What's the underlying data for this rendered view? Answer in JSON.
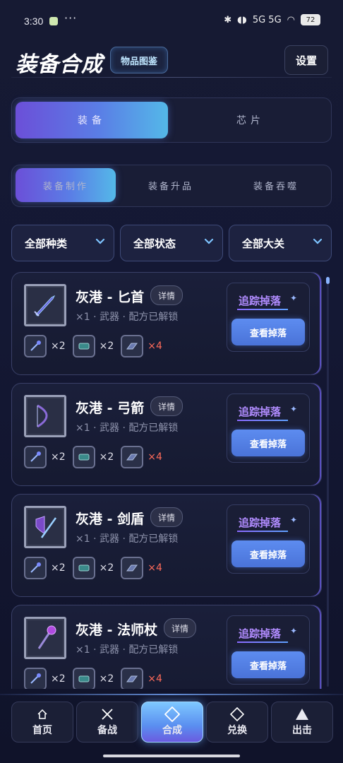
{
  "status_bar": {
    "time": "3:30",
    "dots": "···",
    "network": "5G 5G",
    "battery": "72"
  },
  "header": {
    "title": "装备合成",
    "catalog_label": "物品图鉴",
    "settings_label": "设置"
  },
  "main_tabs": [
    {
      "label": "装备",
      "active": true
    },
    {
      "label": "芯片",
      "active": false
    }
  ],
  "sub_tabs": [
    {
      "label": "装备制作",
      "active": true
    },
    {
      "label": "装备升品",
      "active": false
    },
    {
      "label": "装备吞噬",
      "active": false
    }
  ],
  "filters": [
    {
      "label": "全部种类"
    },
    {
      "label": "全部状态"
    },
    {
      "label": "全部大关"
    }
  ],
  "items": [
    {
      "name": "灰港 - 匕首",
      "detail_label": "详情",
      "meta": "×1 · 武器 · 配方已解锁",
      "icon": "dagger-icon",
      "materials": [
        {
          "icon": "rod-material-icon",
          "qty": "×2",
          "sufficient": true
        },
        {
          "icon": "chip-material-icon",
          "qty": "×2",
          "sufficient": true
        },
        {
          "icon": "gear-material-icon",
          "qty": "×4",
          "sufficient": false
        }
      ],
      "track_label": "追踪掉落",
      "view_label": "查看掉落"
    },
    {
      "name": "灰港 - 弓箭",
      "detail_label": "详情",
      "meta": "×1 · 武器 · 配方已解锁",
      "icon": "bow-icon",
      "materials": [
        {
          "icon": "rod-material-icon",
          "qty": "×2",
          "sufficient": true
        },
        {
          "icon": "chip-material-icon",
          "qty": "×2",
          "sufficient": true
        },
        {
          "icon": "gear-material-icon",
          "qty": "×4",
          "sufficient": false
        }
      ],
      "track_label": "追踪掉落",
      "view_label": "查看掉落"
    },
    {
      "name": "灰港 - 剑盾",
      "detail_label": "详情",
      "meta": "×1 · 武器 · 配方已解锁",
      "icon": "sword-shield-icon",
      "materials": [
        {
          "icon": "rod-material-icon",
          "qty": "×2",
          "sufficient": true
        },
        {
          "icon": "chip-material-icon",
          "qty": "×2",
          "sufficient": true
        },
        {
          "icon": "gear-material-icon",
          "qty": "×4",
          "sufficient": false
        }
      ],
      "track_label": "追踪掉落",
      "view_label": "查看掉落"
    },
    {
      "name": "灰港 - 法师杖",
      "detail_label": "详情",
      "meta": "×1 · 武器 · 配方已解锁",
      "icon": "staff-icon",
      "materials": [
        {
          "icon": "rod-material-icon",
          "qty": "×2",
          "sufficient": true
        },
        {
          "icon": "chip-material-icon",
          "qty": "×2",
          "sufficient": true
        },
        {
          "icon": "gear-material-icon",
          "qty": "×4",
          "sufficient": false
        }
      ],
      "track_label": "追踪掉落",
      "view_label": "查看掉落"
    }
  ],
  "bottom_nav": [
    {
      "label": "首页",
      "icon": "home-icon",
      "active": false
    },
    {
      "label": "备战",
      "icon": "crossed-swords-icon",
      "active": false
    },
    {
      "label": "合成",
      "icon": "diamond-icon",
      "active": true
    },
    {
      "label": "兑换",
      "icon": "diamond-outline-icon",
      "active": false
    },
    {
      "label": "出击",
      "icon": "triangle-icon",
      "active": false
    }
  ],
  "colors": {
    "accent": "#5a7ee6",
    "track": "#b18cff",
    "insufficient": "#ff6b5a"
  }
}
